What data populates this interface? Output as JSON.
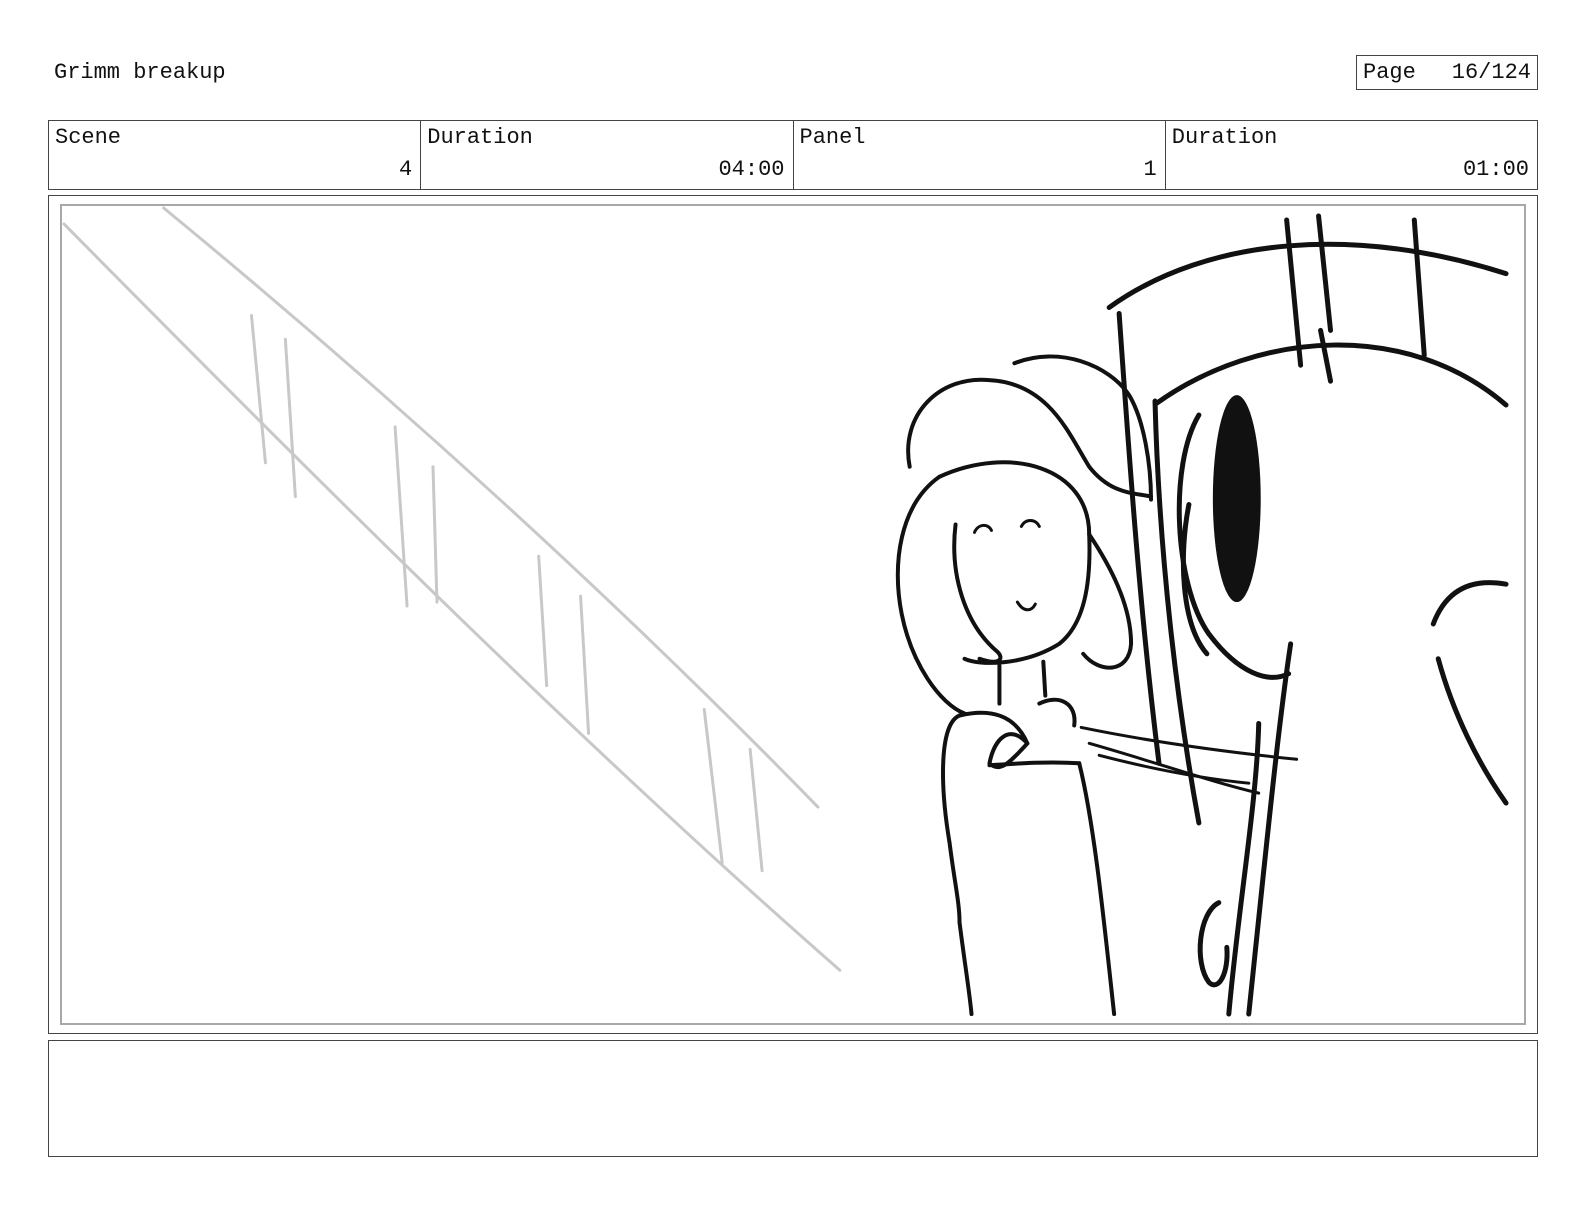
{
  "header": {
    "title": "Grimm breakup",
    "page_label": "Page",
    "page_number": "16/124"
  },
  "info": {
    "scene_label": "Scene",
    "scene_value": "4",
    "scene_duration_label": "Duration",
    "scene_duration_value": "04:00",
    "panel_label": "Panel",
    "panel_value": "1",
    "panel_duration_label": "Duration",
    "panel_duration_value": "01:00"
  },
  "notes": {
    "text": ""
  },
  "colors": {
    "line": "#111111",
    "sketch": "#c8c8c8",
    "frame": "#444444"
  }
}
